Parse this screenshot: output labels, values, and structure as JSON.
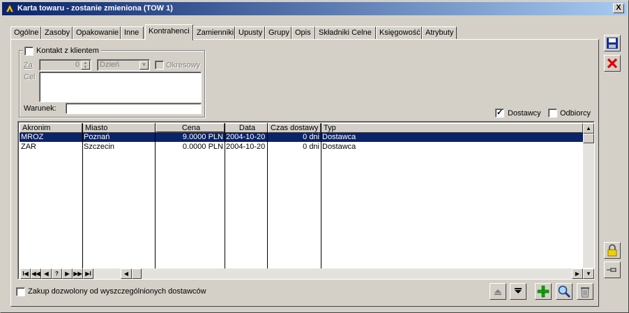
{
  "window": {
    "title": "Karta towaru - zostanie zmieniona (TOW 1)",
    "close_label": "X"
  },
  "tabs": [
    {
      "label": "Ogólne"
    },
    {
      "label": "Zasoby"
    },
    {
      "label": "Opakowanie"
    },
    {
      "label": "Inne"
    },
    {
      "label": "Kontrahenci",
      "active": true
    },
    {
      "label": "Zamienniki"
    },
    {
      "label": "Upusty"
    },
    {
      "label": "Grupy"
    },
    {
      "label": "Opis"
    },
    {
      "label": "Składniki Celne"
    },
    {
      "label": "Księgowość"
    },
    {
      "label": "Atrybuty"
    }
  ],
  "contact": {
    "checkbox_label": "Kontakt z klientem",
    "checked": false,
    "za_label": "Za",
    "za_value": "0",
    "unit_value": "Dzień",
    "periodic_label": "Okresowy",
    "cel_label": "Cel",
    "condition_label": "Warunek:",
    "condition_value": ""
  },
  "filters": {
    "suppliers_label": "Dostawcy",
    "suppliers_checked": true,
    "customers_label": "Odbiorcy",
    "customers_checked": false
  },
  "grid": {
    "columns": [
      "Akronim",
      "Miasto",
      "Cena",
      "Data",
      "Czas dostawy",
      "Typ"
    ],
    "rows": [
      {
        "akronim": "MROZ",
        "miasto": "Poznań",
        "cena": "9.0000 PLN",
        "data": "2004-10-20",
        "czas": "0 dni",
        "typ": "Dostawca",
        "selected": true
      },
      {
        "akronim": "ZAR",
        "miasto": "Szczecin",
        "cena": "0.0000 PLN",
        "data": "2004-10-20",
        "czas": "0 dni",
        "typ": "Dostawca",
        "selected": false
      }
    ],
    "nav_buttons": [
      "I◀",
      "◀◀",
      "◀",
      "?",
      "▶",
      "▶▶",
      "▶I"
    ]
  },
  "footer": {
    "restrict_label": "Zakup dozwolony od wyszczególnionych dostawców",
    "restrict_checked": false
  },
  "colors": {
    "title_start": "#0a246a",
    "title_end": "#a6caf0",
    "selection": "#0a246a",
    "face": "#d4d0c8"
  },
  "icons": {
    "save": "floppy-disk-icon",
    "cancel": "red-x-icon",
    "lock": "padlock-icon",
    "pin": "pushpin-icon",
    "move_up": "arrow-up-icon",
    "move_down": "arrow-down-icon",
    "add": "green-plus-icon",
    "find": "magnifier-icon",
    "delete": "trash-bin-icon"
  }
}
